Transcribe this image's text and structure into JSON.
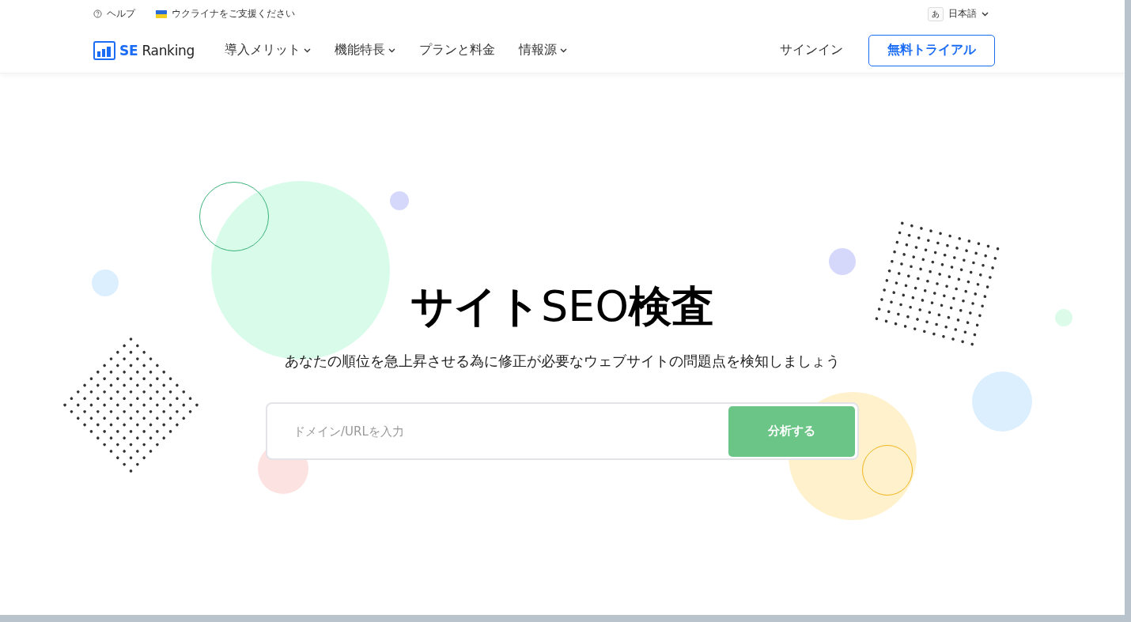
{
  "topbar": {
    "help": "ヘルプ",
    "ukraine": "ウクライナをご支援ください",
    "language": {
      "icon": "あ",
      "label": "日本語"
    }
  },
  "nav": {
    "logo": {
      "mark": "SE",
      "name": "Ranking"
    },
    "items": [
      {
        "label": "導入メリット",
        "dropdown": true
      },
      {
        "label": "機能特長",
        "dropdown": true
      },
      {
        "label": "プランと料金",
        "dropdown": false
      },
      {
        "label": "情報源",
        "dropdown": true
      }
    ],
    "signin": "サインイン",
    "trial": "無料トライアル"
  },
  "hero": {
    "title": "**サイト**SEO**検査**",
    "subtitle": "あなたの順位を急上昇させる為に修正が必要なウェブサイトの問題点を検知しましょう",
    "search": {
      "placeholder": "ドメイン/URLを入力",
      "button": "分析する"
    }
  }
}
